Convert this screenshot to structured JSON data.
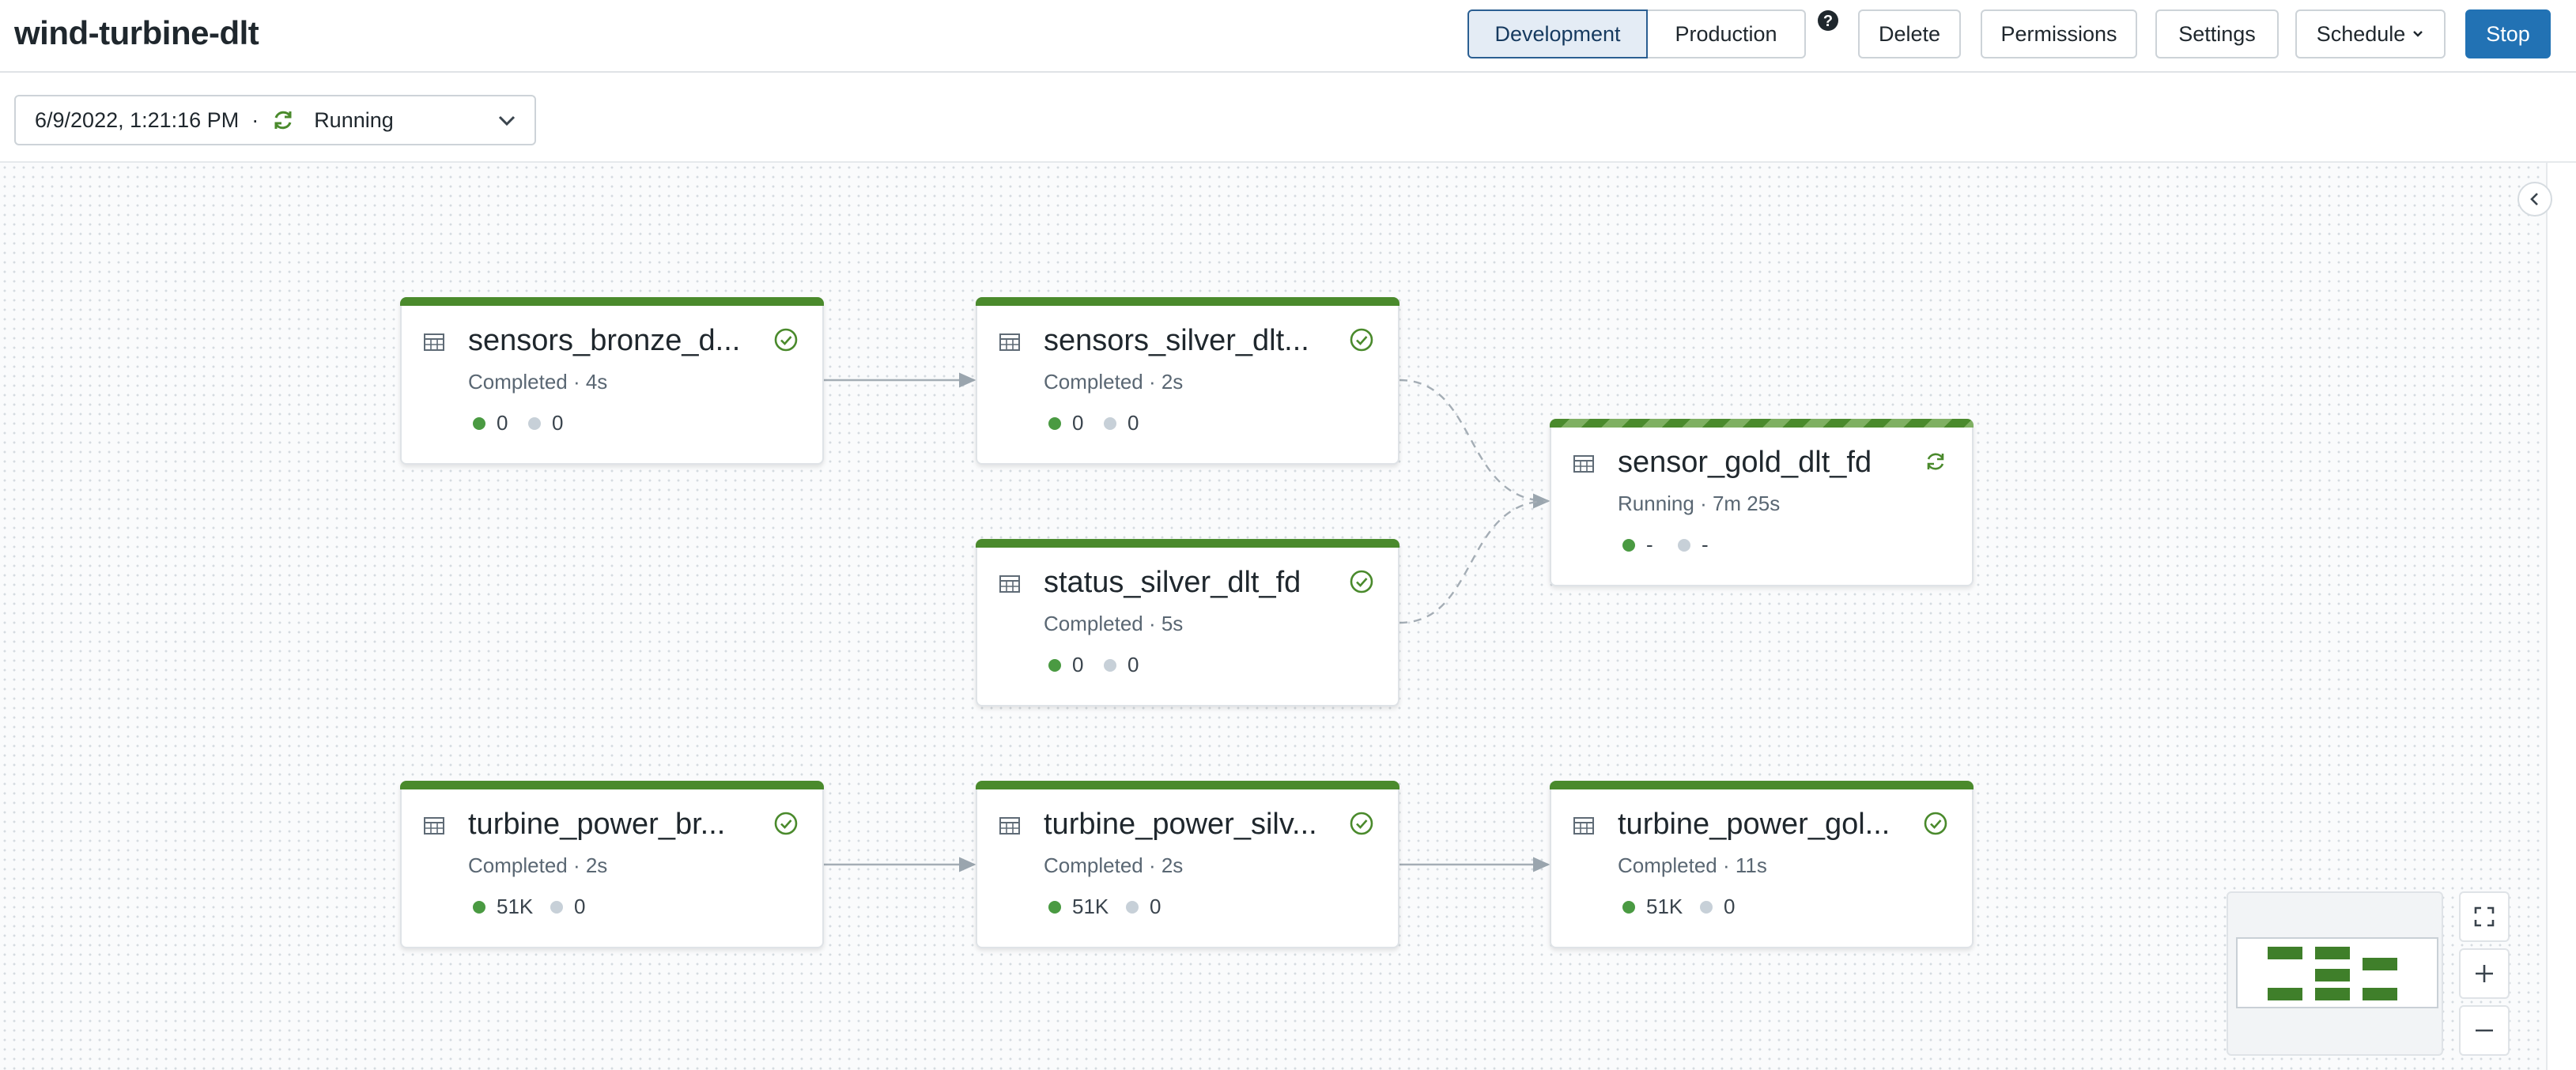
{
  "header": {
    "title": "wind-turbine-dlt",
    "mode_development": "Development",
    "mode_production": "Production",
    "delete": "Delete",
    "permissions": "Permissions",
    "settings": "Settings",
    "schedule": "Schedule",
    "stop": "Stop"
  },
  "run": {
    "timestamp": "6/9/2022, 1:21:16 PM",
    "separator": "·",
    "status": "Running"
  },
  "nodes": [
    {
      "name": "sensors_bronze_d...",
      "status": "Completed · 4s",
      "rows_written": "0",
      "rows_dropped": "0",
      "state": "completed"
    },
    {
      "name": "sensors_silver_dlt...",
      "status": "Completed · 2s",
      "rows_written": "0",
      "rows_dropped": "0",
      "state": "completed"
    },
    {
      "name": "status_silver_dlt_fd",
      "status": "Completed · 5s",
      "rows_written": "0",
      "rows_dropped": "0",
      "state": "completed"
    },
    {
      "name": "sensor_gold_dlt_fd",
      "status": "Running · 7m 25s",
      "rows_written": "-",
      "rows_dropped": "-",
      "state": "running"
    },
    {
      "name": "turbine_power_br...",
      "status": "Completed · 2s",
      "rows_written": "51K",
      "rows_dropped": "0",
      "state": "completed"
    },
    {
      "name": "turbine_power_silv...",
      "status": "Completed · 2s",
      "rows_written": "51K",
      "rows_dropped": "0",
      "state": "completed"
    },
    {
      "name": "turbine_power_gol...",
      "status": "Completed · 11s",
      "rows_written": "51K",
      "rows_dropped": "0",
      "state": "completed"
    }
  ],
  "colors": {
    "success": "#4a8a2c",
    "primary": "#2272b4",
    "written_dot": "#4a9a42",
    "dropped_dot": "#c7d0d8"
  },
  "icons": {
    "help": "question-circle-icon",
    "run_status": "refresh-icon",
    "dropdown": "chevron-down-icon",
    "table": "table-icon",
    "completed": "check-circle-icon",
    "running": "refresh-icon",
    "collapse": "chevron-left-icon",
    "fullscreen": "fullscreen-icon",
    "zoom_in": "plus-icon",
    "zoom_out": "minus-icon"
  }
}
